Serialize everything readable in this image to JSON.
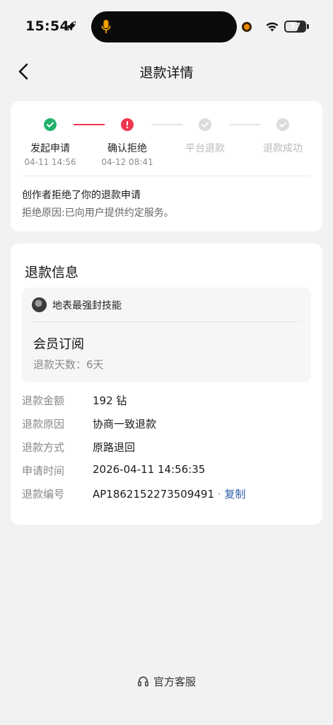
{
  "status_bar": {
    "time": "15:54",
    "battery": "37"
  },
  "nav": {
    "title": "退款详情"
  },
  "progress": {
    "steps": [
      {
        "label": "发起申请",
        "time": "04-11 14:56",
        "state": "done"
      },
      {
        "label": "确认拒绝",
        "time": "04-12 08:41",
        "state": "rejected"
      },
      {
        "label": "平台退款",
        "time": "",
        "state": "inactive"
      },
      {
        "label": "退款成功",
        "time": "",
        "state": "inactive"
      }
    ],
    "message_title": "创作者拒绝了你的退款申请",
    "message_reason": "拒绝原因:已向用户提供约定服务。"
  },
  "refund_info": {
    "title": "退款信息",
    "creator_name": "地表最强封技能",
    "product_name": "会员订阅",
    "refund_days": "退款天数：6天",
    "rows": [
      {
        "label": "退款金额",
        "value": "192 钻"
      },
      {
        "label": "退款原因",
        "value": "协商一致退款"
      },
      {
        "label": "退款方式",
        "value": "原路退回"
      },
      {
        "label": "申请时间",
        "value": "2026-04-11 14:56:35"
      },
      {
        "label": "退款编号",
        "value": "AP1862152273509491"
      }
    ],
    "copy_separator": " · ",
    "copy_label": "复制"
  },
  "footer": {
    "service_label": "官方客服"
  },
  "colors": {
    "success": "#21b16a",
    "error": "#f0364f",
    "inactive": "#d9d9d9",
    "link": "#2c5fa8"
  },
  "icons": [
    "rocket-icon",
    "microphone-icon",
    "wifi-icon",
    "battery-icon",
    "back-arrow-icon",
    "check-icon",
    "exclamation-icon",
    "headset-icon"
  ]
}
